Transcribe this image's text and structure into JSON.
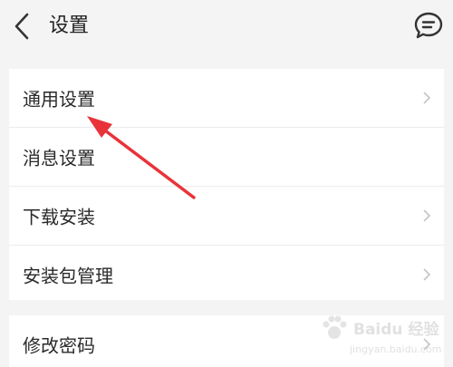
{
  "header": {
    "title": "设置",
    "back_icon": "chevron-left-icon",
    "feedback_icon": "chat-bubble-icon"
  },
  "settings_group_1": [
    {
      "label": "通用设置",
      "chevron": true
    },
    {
      "label": "消息设置",
      "chevron": false
    },
    {
      "label": "下载安装",
      "chevron": true
    },
    {
      "label": "安装包管理",
      "chevron": true
    }
  ],
  "settings_group_2": [
    {
      "label": "修改密码",
      "chevron": true
    }
  ],
  "annotation": {
    "color": "#e8333a",
    "target": "通用设置"
  },
  "watermark": {
    "brand": "Baidu 经验",
    "url": "jingyan.baidu.com"
  }
}
